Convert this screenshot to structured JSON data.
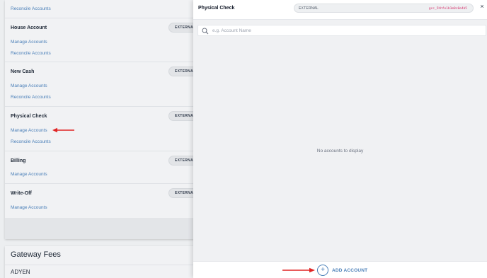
{
  "left_panel": {
    "groups": [
      {
        "title": "",
        "tag": "",
        "links": [
          "Reconcile Accounts"
        ]
      },
      {
        "title": "House Account",
        "tag": "EXTERNAL",
        "links": [
          "Manage Accounts",
          "Reconcile Accounts"
        ]
      },
      {
        "title": "New Cash",
        "tag": "EXTERNAL",
        "links": [
          "Manage Accounts",
          "Reconcile Accounts"
        ]
      },
      {
        "title": "Physical Check",
        "tag": "EXTERNAL",
        "links": [
          "Manage Accounts",
          "Reconcile Accounts"
        ]
      },
      {
        "title": "Billing",
        "tag": "EXTERNAL",
        "links": [
          "Manage Accounts"
        ]
      },
      {
        "title": "Write-Off",
        "tag": "EXTERNAL",
        "links": [
          "Manage Accounts"
        ]
      }
    ],
    "gateway": {
      "title": "Gateway Fees",
      "items": [
        "ADYEN"
      ]
    }
  },
  "drawer": {
    "title": "Physical Check",
    "tag": "EXTERNAL",
    "id": "gcc_5hhfe1b1m0c0e4b5",
    "close_glyph": "×",
    "search": {
      "placeholder": "e.g. Account Name",
      "value": ""
    },
    "empty_message": "No accounts to display",
    "add_button": {
      "glyph": "+",
      "label": "ADD ACCOUNT"
    }
  },
  "colors": {
    "link": "#4a7fb8",
    "annotation_arrow": "#e02424",
    "id_text": "#d6336c"
  }
}
